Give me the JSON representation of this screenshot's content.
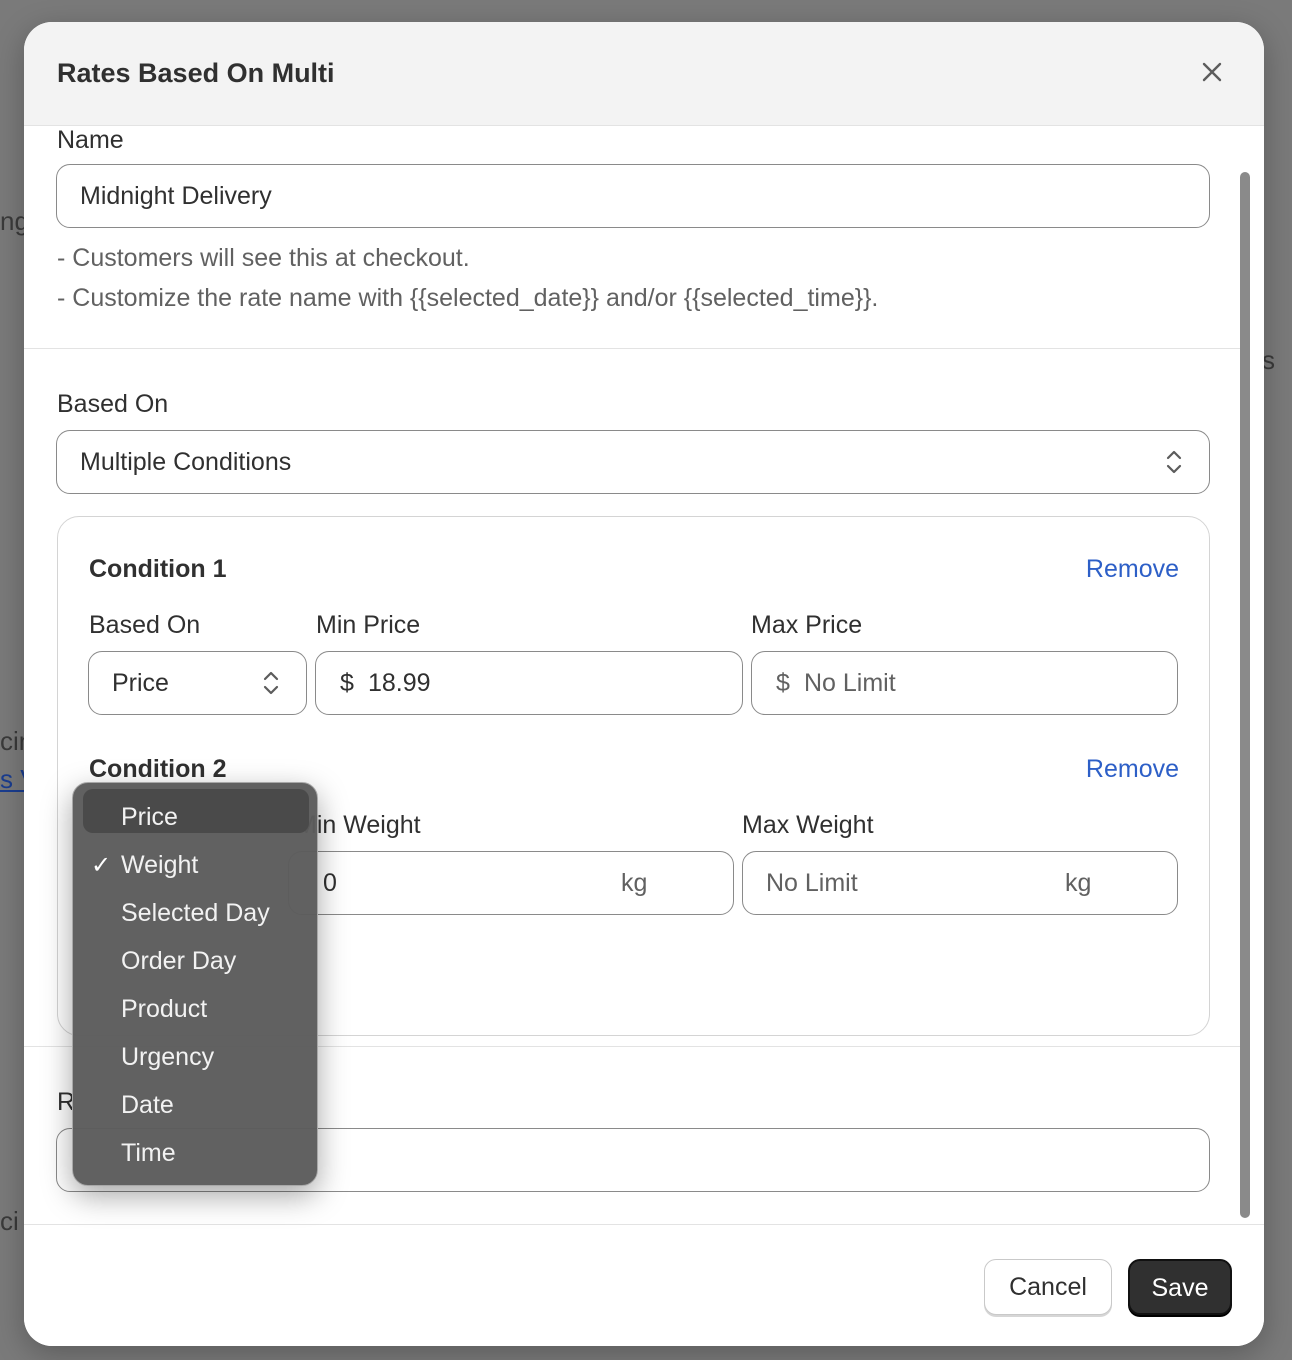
{
  "background": {
    "frag_ng": "ng",
    "frag_s": "s",
    "frag_cin": "cin",
    "frag_link": "s V",
    "frag_ci": "ci"
  },
  "modal": {
    "title": "Rates Based On Multi",
    "close_icon": "close-icon"
  },
  "name_section": {
    "label": "Name",
    "value": "Midnight Delivery",
    "hint_1": "- Customers will see this at checkout.",
    "hint_2": "- Customize the rate name with {{selected_date}} and/or {{selected_time}}."
  },
  "based_on": {
    "label": "Based On",
    "value": "Multiple Conditions"
  },
  "conditions": [
    {
      "title": "Condition 1",
      "remove_label": "Remove",
      "based_on_label": "Based On",
      "based_on_value": "Price",
      "min_label": "Min Price",
      "min_prefix": "$",
      "min_value": "18.99",
      "max_label": "Max Price",
      "max_prefix": "$",
      "max_placeholder": "No Limit"
    },
    {
      "title": "Condition 2",
      "remove_label": "Remove",
      "min_label": "Min Weight",
      "min_value": "0",
      "min_suffix": "kg",
      "max_label": "Max Weight",
      "max_placeholder": "No Limit",
      "max_suffix": "kg"
    }
  ],
  "rate_section": {
    "label_fragment": "R"
  },
  "dropdown": {
    "selected": "Weight",
    "check_icon": "checkmark-icon",
    "options": [
      "Price",
      "Weight",
      "Selected Day",
      "Order Day",
      "Product",
      "Urgency",
      "Date",
      "Time"
    ]
  },
  "footer": {
    "cancel_label": "Cancel",
    "save_label": "Save"
  },
  "colors": {
    "accent_link": "#2d5fc7",
    "primary_button": "#303030",
    "overlay": "#7a7a7a"
  }
}
